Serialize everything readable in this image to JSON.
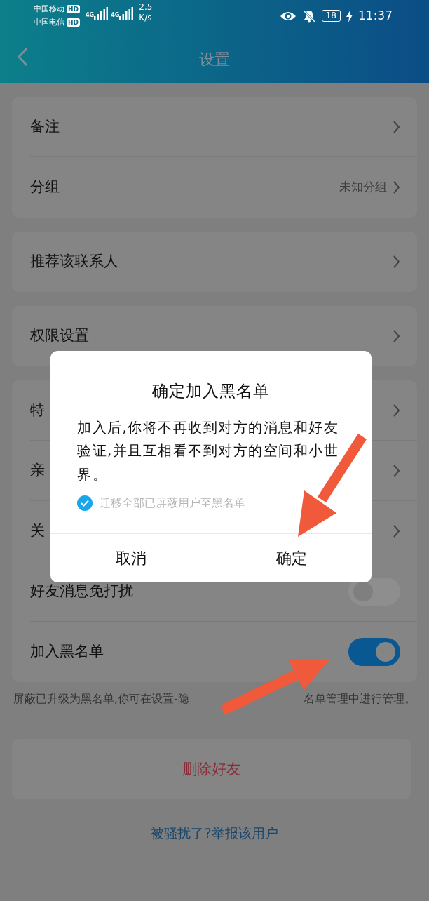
{
  "status_bar": {
    "carrier_1": "中国移动",
    "carrier_2": "中国电信",
    "hd_1": "HD",
    "hd_2": "HD",
    "network_1": "4G",
    "network_2": "4G",
    "speed": "2.5",
    "speed_unit": "K/s",
    "battery": "18",
    "time": "11:37"
  },
  "header": {
    "title": "设置"
  },
  "groups": [
    {
      "items": [
        {
          "kind": "link",
          "label": "备注"
        },
        {
          "kind": "link",
          "label": "分组",
          "value": "未知分组"
        }
      ]
    },
    {
      "items": [
        {
          "kind": "link",
          "label": "推荐该联系人"
        }
      ]
    },
    {
      "items": [
        {
          "kind": "link",
          "label": "权限设置"
        }
      ]
    },
    {
      "items": [
        {
          "kind": "link",
          "label": "特"
        },
        {
          "kind": "link",
          "label": "亲"
        },
        {
          "kind": "link",
          "label": "关"
        },
        {
          "kind": "toggle",
          "label": "好友消息免打扰",
          "on": false
        },
        {
          "kind": "toggle",
          "label": "加入黑名单",
          "on": true
        }
      ]
    }
  ],
  "footnote_parts": [
    "屏蔽已升级为黑名单,你可在设置-隐",
    "名单管理中进行管理。"
  ],
  "delete_button": "删除好友",
  "report_link": "被骚扰了?举报该用户",
  "dialog": {
    "title": "确定加入黑名单",
    "message": "加入后,你将不再收到对方的消息和好友验证,并且互相看不到对方的空间和小世界。",
    "checkbox": {
      "label": "迁移全部已屏蔽用户至黑名单",
      "checked": true
    },
    "buttons": [
      "取消",
      "确定"
    ]
  }
}
